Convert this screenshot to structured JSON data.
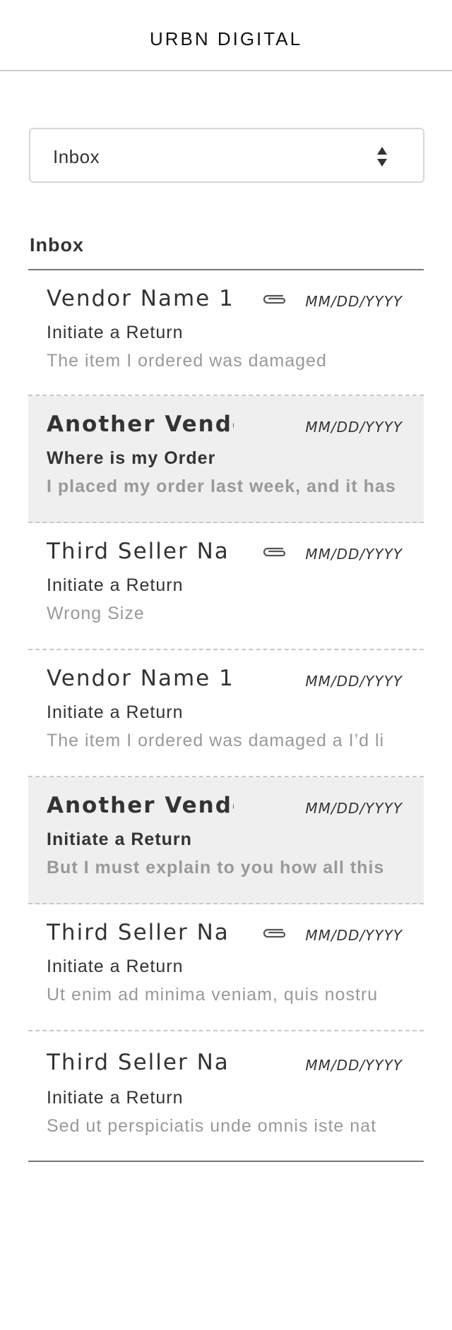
{
  "header": {
    "brand": "URBN DIGITAL"
  },
  "filter": {
    "selected": "Inbox"
  },
  "section": {
    "title": "Inbox"
  },
  "messages": [
    {
      "vendor": "Vendor Name 1",
      "attachment": true,
      "date": "MM/DD/YYYY",
      "subject": "Initiate a Return",
      "preview": "The item I ordered was damaged",
      "unread": false
    },
    {
      "vendor": "Another Vendor",
      "attachment": false,
      "date": "MM/DD/YYYY",
      "subject": "Where is my Order",
      "preview": "I placed my order last week, and it has",
      "unread": true
    },
    {
      "vendor": "Third Seller Na",
      "attachment": true,
      "date": "MM/DD/YYYY",
      "subject": "Initiate a Return",
      "preview": "Wrong Size",
      "unread": false
    },
    {
      "vendor": "Vendor Name 1",
      "attachment": false,
      "date": "MM/DD/YYYY",
      "subject": "Initiate a Return",
      "preview": "The item I ordered was damaged a I’d li",
      "unread": false
    },
    {
      "vendor": "Another Vendor",
      "attachment": false,
      "date": "MM/DD/YYYY",
      "subject": "Initiate a Return",
      "preview": "But I must explain to you how all this",
      "unread": true
    },
    {
      "vendor": "Third Seller Na",
      "attachment": true,
      "date": "MM/DD/YYYY",
      "subject": "Initiate a Return",
      "preview": "Ut enim ad minima veniam, quis nostru",
      "unread": false
    },
    {
      "vendor": "Third Seller Na",
      "attachment": false,
      "date": "MM/DD/YYYY",
      "subject": "Initiate a Return",
      "preview": "Sed ut perspiciatis unde omnis iste nat",
      "unread": false
    }
  ],
  "icons": {
    "attachment": "paperclip-icon",
    "select_arrows": "sort-arrows-icon"
  },
  "colors": {
    "unread_background": "#efefef",
    "preview_text": "#999999",
    "divider": "#c8c8c8"
  }
}
